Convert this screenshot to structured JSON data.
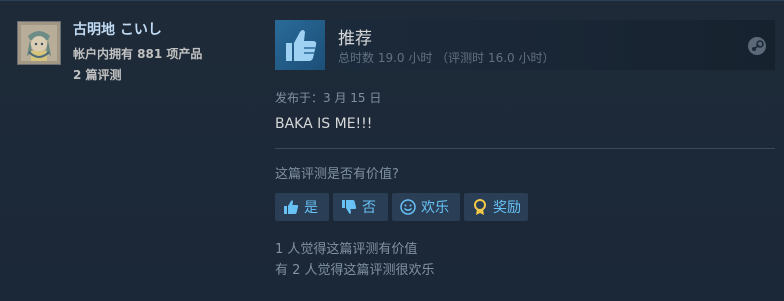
{
  "author": {
    "name": "古明地 こいし",
    "products": "帐户内拥有 881 项产品",
    "reviews": "2 篇评测"
  },
  "review": {
    "verdict": "推荐",
    "hours": "总时数 19.0 小时 （评测时 16.0 小时）",
    "posted": "发布于：3 月 15 日",
    "text": "BAKA IS ME!!!"
  },
  "feedback": {
    "question": "这篇评测是否有价值?",
    "yes_label": "是",
    "no_label": "否",
    "funny_label": "欢乐",
    "award_label": "奖励",
    "helpful_count": "1 人觉得这篇评测有价值",
    "funny_count": "有 2 人觉得这篇评测很欢乐"
  },
  "colors": {
    "background": "#1b2838",
    "link_blue": "#67c1f5",
    "button_bg": "#2a3f55",
    "award_gold": "#f3c84b"
  }
}
